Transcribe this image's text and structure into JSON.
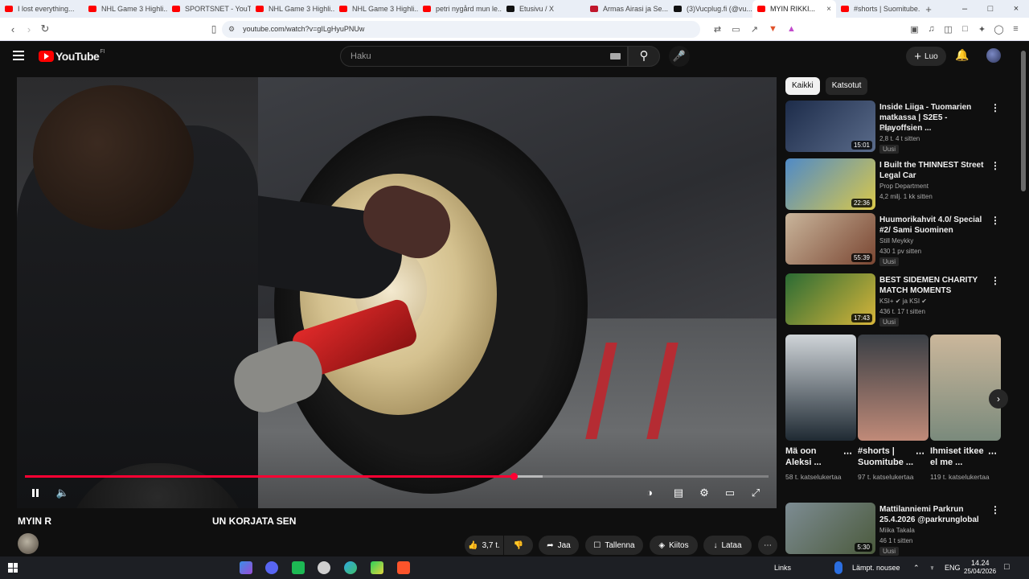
{
  "browser": {
    "tabs": [
      {
        "label": "I lost everything...",
        "favicon_color": "#ff0000"
      },
      {
        "label": "NHL Game 3 Highli...",
        "favicon_color": "#ff0000"
      },
      {
        "label": "SPORTSNET - YouTu...",
        "favicon_color": "#ff0000"
      },
      {
        "label": "NHL Game 3 Highli...",
        "favicon_color": "#ff0000"
      },
      {
        "label": "NHL Game 3 Highli...",
        "favicon_color": "#ff0000"
      },
      {
        "label": "petri nygård mun le...",
        "favicon_color": "#ff0000"
      },
      {
        "label": "Etusivu / X",
        "favicon_color": "#111111"
      },
      {
        "label": "Armas Airasi ja Se...",
        "favicon_color": "#c0162c"
      },
      {
        "label": "(3)Vucplug.fi (@vu...",
        "favicon_color": "#111111"
      },
      {
        "label": "MYIN RIKKI...",
        "favicon_color": "#ff0000",
        "active": true
      },
      {
        "label": "#shorts | Suomitube...",
        "favicon_color": "#ff0000"
      }
    ],
    "url": "youtube.com/watch?v=gILgHyuPNUw"
  },
  "youtube": {
    "logo_text": "YouTube",
    "region": "FI",
    "search_placeholder": "Haku",
    "create_label": "Luo"
  },
  "player": {
    "progress_fraction": 0.657,
    "buffer_fraction": 0.696
  },
  "video": {
    "title_left": "MYIN R",
    "title_right": "UN KORJATA SEN",
    "likes": "3,7 t.",
    "share_label": "Jaa",
    "save_label": "Tallenna",
    "thanks_label": "Kiitos",
    "download_label": "Lataa"
  },
  "sidebar": {
    "chips": [
      "Kaikki",
      "Katsotut"
    ],
    "recommendations": [
      {
        "title": "Inside Liiga - Tuomarien matkassa | S2E5 - Playoffsien ...",
        "channel": "Liiga",
        "meta": "2,8 t.   4 t sitten",
        "badge": "Uusi",
        "duration": "15:01",
        "thumb_colors": [
          "#1d2c4a",
          "#5a6b8a"
        ]
      },
      {
        "title": "I Built the THINNEST Street Legal Car",
        "channel": "Prop Department",
        "meta": "4,2 milj.   1 kk sitten",
        "badge": "",
        "duration": "22:36",
        "thumb_colors": [
          "#4f8ac7",
          "#d9c84a"
        ]
      },
      {
        "title": "Huumorikahvit 4.0/ Special #2/ Sami Suominen",
        "channel": "Still Meykky",
        "meta": "430   1 pv sitten",
        "badge": "Uusi",
        "duration": "55:39",
        "thumb_colors": [
          "#c9b59b",
          "#7a4632"
        ]
      },
      {
        "title": "BEST SIDEMEN CHARITY MATCH MOMENTS",
        "channel": "KSI+ ✔ ja KSI ✔",
        "meta": "436 t.   17 t sitten",
        "badge": "Uusi",
        "duration": "17:43",
        "thumb_colors": [
          "#2a6b34",
          "#d7b53a"
        ]
      },
      {
        "title": "Mattilanniemi Parkrun 25.4.2026 @parkrunglobal",
        "channel": "Miika Takala",
        "meta": "46   1 t sitten",
        "badge": "Uusi",
        "duration": "5:30",
        "thumb_colors": [
          "#7d8c93",
          "#4b5a3c"
        ]
      }
    ],
    "shorts": [
      {
        "title": "Mä oon Aleksi ...",
        "views": "58 t. katselukertaa",
        "colors": [
          "#cfd4d8",
          "#1f2a33"
        ]
      },
      {
        "title": "#shorts | Suomitube ...",
        "views": "97 t. katselukertaa",
        "colors": [
          "#3a3f45",
          "#c08a78"
        ]
      },
      {
        "title": "Ihmiset itkee el me ...",
        "views": "119 t. katselukertaa",
        "colors": [
          "#cbb79b",
          "#7a8a7c"
        ]
      }
    ]
  },
  "taskbar": {
    "links_label": "Links",
    "weather_text": "Lämpt. nousee",
    "lang": "ENG",
    "time": "14.24",
    "date": "25/04/2026"
  }
}
